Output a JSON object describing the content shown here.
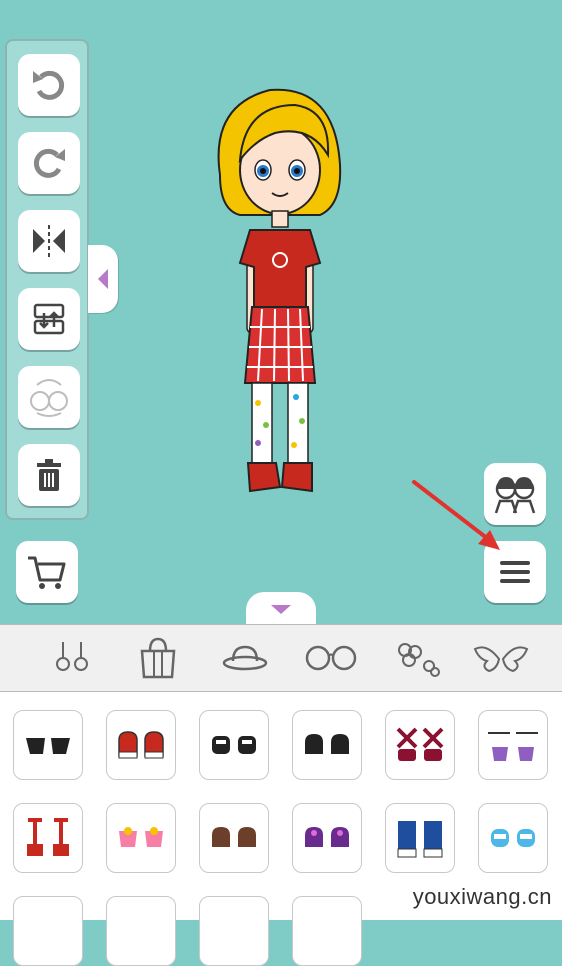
{
  "watermark": "youxiwang.cn",
  "colors": {
    "stage_background": "#7fccc6",
    "toolbar_icon": "#555555",
    "category_icon": "#666666",
    "arrow_annotation": "#e0332e",
    "collapse_arrow": "#b77ac9"
  },
  "toolbar": {
    "items": [
      {
        "name": "undo",
        "icon": "undo-icon",
        "enabled": true
      },
      {
        "name": "redo",
        "icon": "redo-icon",
        "enabled": true
      },
      {
        "name": "flip",
        "icon": "flip-horizontal-icon",
        "enabled": true
      },
      {
        "name": "layer",
        "icon": "layer-swap-icon",
        "enabled": true
      },
      {
        "name": "swap-character",
        "icon": "swap-character-icon",
        "enabled": false
      },
      {
        "name": "delete",
        "icon": "trash-icon",
        "enabled": true
      }
    ]
  },
  "buttons": {
    "shop": "cart-icon",
    "characters": "two-characters-icon",
    "menu": "hamburger-menu-icon"
  },
  "categories": [
    "earring-icon",
    "bag-icon",
    "hat-icon",
    "glasses-icon",
    "flower-icon",
    "wings-icon"
  ],
  "items_grid": {
    "selected_category": "shoes",
    "rows": [
      [
        "black-flats",
        "red-sneakers",
        "black-platforms",
        "black-slippers",
        "burgundy-strap-heels",
        "purple-ribbon-boots"
      ],
      [
        "red-high-boots",
        "pink-bow-flats",
        "brown-loafers",
        "purple-bow-shoes",
        "blue-high-tops",
        "blue-sandals"
      ]
    ]
  }
}
